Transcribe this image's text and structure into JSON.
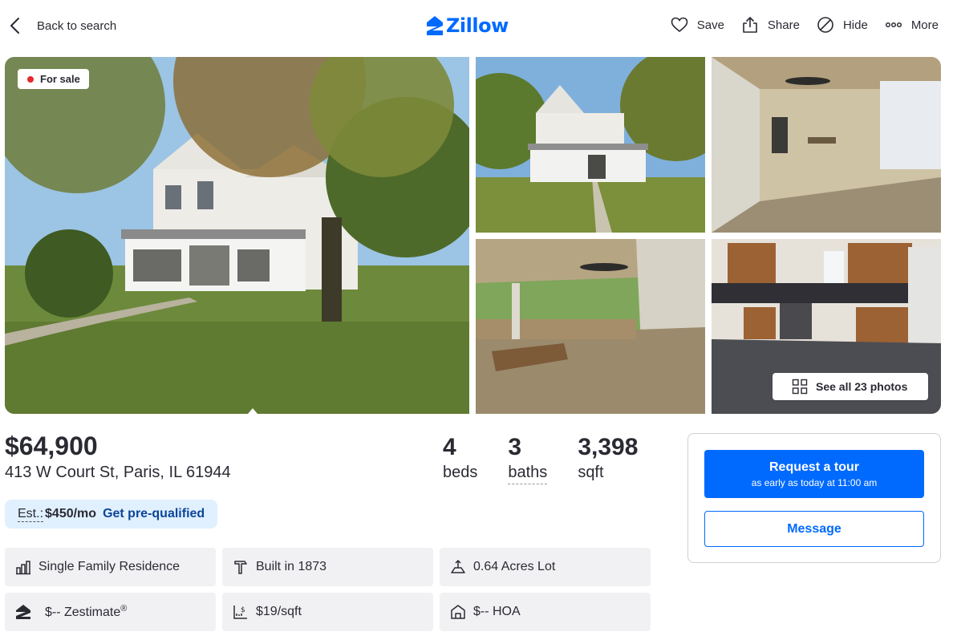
{
  "header": {
    "back_label": "Back to search",
    "logo_text": "Zillow",
    "actions": [
      {
        "label": "Save",
        "icon": "heart-icon"
      },
      {
        "label": "Share",
        "icon": "share-icon"
      },
      {
        "label": "Hide",
        "icon": "hide-icon"
      },
      {
        "label": "More",
        "icon": "more-icon"
      }
    ]
  },
  "gallery": {
    "status_badge": "For sale",
    "see_all_label": "See all 23 photos"
  },
  "listing": {
    "price": "$64,900",
    "address": "413 W Court St, Paris, IL 61944",
    "beds": {
      "value": "4",
      "label": "beds"
    },
    "baths": {
      "value": "3",
      "label": "baths"
    },
    "sqft": {
      "value": "3,398",
      "label": "sqft"
    },
    "estimate": {
      "label": "Est.:",
      "value": "$450/mo",
      "link": "Get pre-qualified"
    }
  },
  "features": [
    {
      "label": "Single Family Residence",
      "icon": "home-type-icon"
    },
    {
      "label": "Built in 1873",
      "icon": "hammer-icon"
    },
    {
      "label": "0.64 Acres Lot",
      "icon": "lot-icon"
    },
    {
      "label": "$-- Zestimate",
      "sup": "®",
      "icon": "zestimate-icon"
    },
    {
      "label": "$19/sqft",
      "icon": "price-per-sqft-icon"
    },
    {
      "label": "$-- HOA",
      "icon": "hoa-icon"
    }
  ],
  "tour_card": {
    "primary_label": "Request a tour",
    "primary_sub": "as early as today at 11:00 am",
    "secondary_label": "Message"
  },
  "colors": {
    "brand": "#006aff",
    "for_sale_dot": "#e4292b",
    "estimate_bg": "#e0f0ff",
    "tile_bg": "#f1f1f4"
  }
}
